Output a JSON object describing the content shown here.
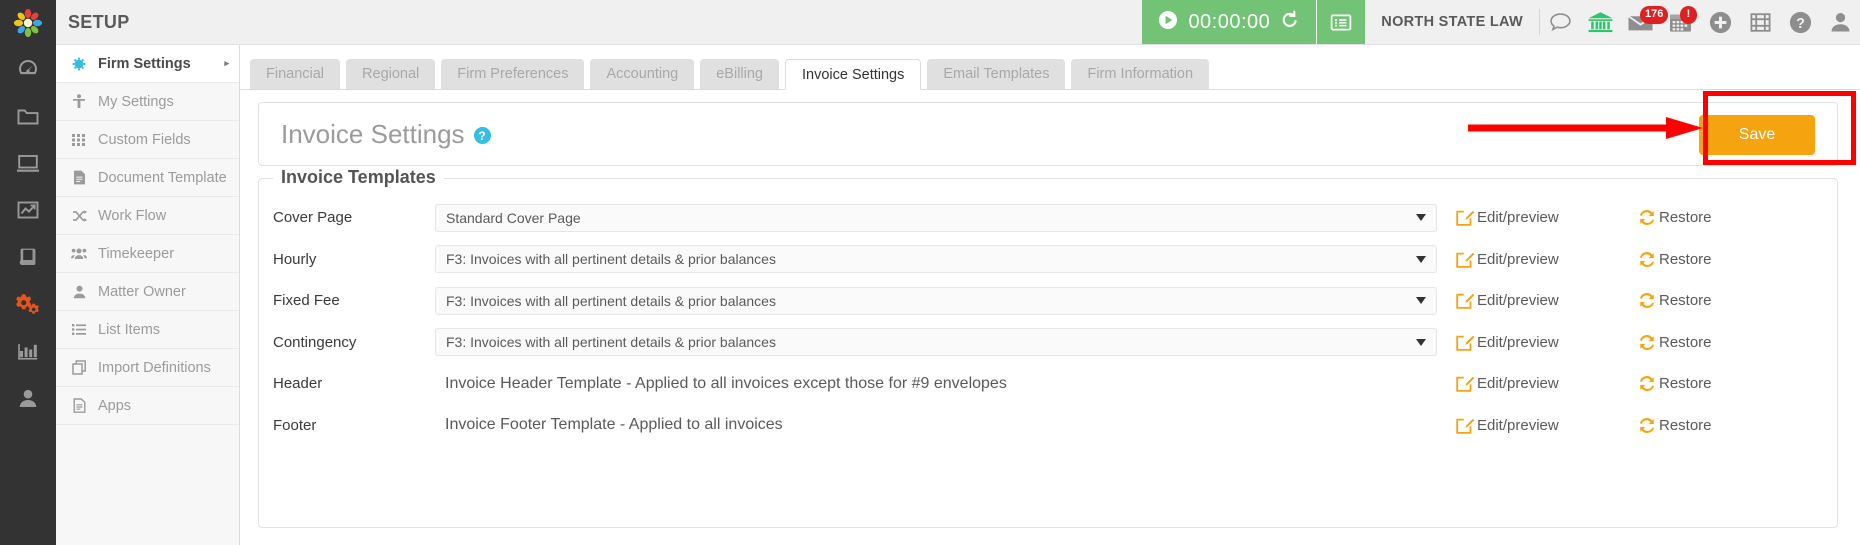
{
  "header": {
    "app_title": "SETUP",
    "timer": {
      "value": "00:00:00",
      "play_icon": "play-circle-icon",
      "reset_icon": "reset-arrow-icon",
      "list_icon": "timer-list-icon"
    },
    "firm_name": "NORTH STATE LAW",
    "icons": [
      {
        "name": "chat-bubble-icon",
        "badge": null
      },
      {
        "name": "bank-icon",
        "badge": null
      },
      {
        "name": "envelope-icon",
        "badge": "176"
      },
      {
        "name": "calendar-icon",
        "badge": "!"
      },
      {
        "name": "add-circle-icon",
        "badge": null
      },
      {
        "name": "film-icon",
        "badge": null
      },
      {
        "name": "help-circle-icon",
        "badge": null
      },
      {
        "name": "user-avatar-icon",
        "badge": null
      }
    ]
  },
  "rail": {
    "logo": "flower-logo",
    "items": [
      {
        "name": "dashboard-icon",
        "active": false
      },
      {
        "name": "folder-icon",
        "active": false
      },
      {
        "name": "desktop-icon",
        "active": false
      },
      {
        "name": "chart-line-icon",
        "active": false
      },
      {
        "name": "book-icon",
        "active": false
      },
      {
        "name": "gears-icon",
        "active": true
      },
      {
        "name": "bar-chart-icon",
        "active": false
      },
      {
        "name": "user-icon",
        "active": false
      }
    ]
  },
  "sidebar": {
    "items": [
      {
        "label": "Firm Settings",
        "icon": "gear-dot-icon",
        "active": true,
        "caret": "▸"
      },
      {
        "label": "My Settings",
        "icon": "person-settings-icon",
        "active": false,
        "caret": ""
      },
      {
        "label": "Custom Fields",
        "icon": "grid-dots-icon",
        "active": false,
        "caret": ""
      },
      {
        "label": "Document Template",
        "icon": "document-icon",
        "active": false,
        "caret": ""
      },
      {
        "label": "Work Flow",
        "icon": "shuffle-icon",
        "active": false,
        "caret": ""
      },
      {
        "label": "Timekeeper",
        "icon": "users-group-icon",
        "active": false,
        "caret": ""
      },
      {
        "label": "Matter Owner",
        "icon": "user-solid-icon",
        "active": false,
        "caret": ""
      },
      {
        "label": "List Items",
        "icon": "list-icon",
        "active": false,
        "caret": ""
      },
      {
        "label": "Import Definitions",
        "icon": "copy-icon",
        "active": false,
        "caret": ""
      },
      {
        "label": "Apps",
        "icon": "file-lines-icon",
        "active": false,
        "caret": ""
      }
    ]
  },
  "tabs": [
    {
      "label": "Financial",
      "active": false
    },
    {
      "label": "Regional",
      "active": false
    },
    {
      "label": "Firm Preferences",
      "active": false
    },
    {
      "label": "Accounting",
      "active": false
    },
    {
      "label": "eBilling",
      "active": false
    },
    {
      "label": "Invoice Settings",
      "active": true
    },
    {
      "label": "Email Templates",
      "active": false
    },
    {
      "label": "Firm Information",
      "active": false
    }
  ],
  "main": {
    "page_title": "Invoice Settings",
    "help_glyph": "?",
    "save_label": "Save",
    "templates_legend": "Invoice Templates",
    "edit_label": "Edit/preview",
    "restore_label": "Restore",
    "rows": [
      {
        "label": "Cover Page",
        "value": "Standard Cover Page",
        "type": "select"
      },
      {
        "label": "Hourly",
        "value": "F3: Invoices with all pertinent details & prior balances",
        "type": "select"
      },
      {
        "label": "Fixed Fee",
        "value": "F3: Invoices with all pertinent details & prior balances",
        "type": "select"
      },
      {
        "label": "Contingency",
        "value": "F3: Invoices with all pertinent details & prior balances",
        "type": "select"
      },
      {
        "label": "Header",
        "value": "Invoice Header Template - Applied to all invoices except those for #9 envelopes",
        "type": "static"
      },
      {
        "label": "Footer",
        "value": "Invoice Footer Template - Applied to all invoices",
        "type": "static"
      }
    ]
  },
  "annotation": {
    "box_color": "#ff0000",
    "arrow_color": "#ff0000",
    "target": "save-button"
  },
  "colors": {
    "accent_orange": "#f5a30f",
    "timer_green": "#72c375",
    "badge_red": "#e02020",
    "rail_dark": "#333333",
    "help_blue": "#35bde4"
  }
}
